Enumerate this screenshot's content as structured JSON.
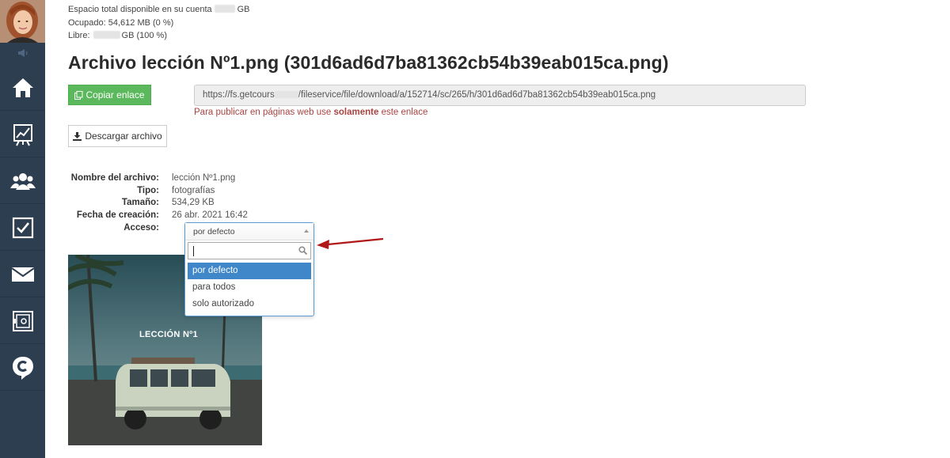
{
  "storage": {
    "total_label": "Espacio total disponible en su cuenta",
    "total_unit": "GB",
    "used": "Ocupado: 54,612 MB (0 %)",
    "free_label": "Libre:",
    "free_unit": "GB (100 %)"
  },
  "file": {
    "title": "Archivo lección Nº1.png (301d6ad6d7ba81362cb54b39eab015ca.png)",
    "copy_button": "Copiar enlace",
    "url_prefix": "https://fs.getcours",
    "url_suffix": "/fileservice/file/download/a/152714/sc/265/h/301d6ad6d7ba81362cb54b39eab015ca.png",
    "warning_pre": "Para publicar en páginas web use",
    "warning_bold": "solamente",
    "warning_post": "este enlace",
    "download_button": "Descargar archivo"
  },
  "properties": [
    {
      "label": "Nombre del archivo:",
      "value": "lección Nº1.png"
    },
    {
      "label": "Tipo:",
      "value": "fotografías"
    },
    {
      "label": "Tamaño:",
      "value": "534,29 KB"
    },
    {
      "label": "Fecha de creación:",
      "value": "26 abr. 2021 16:42"
    },
    {
      "label": "Acceso:",
      "value": ""
    }
  ],
  "access_dropdown": {
    "selected": "por defecto",
    "search_value": "",
    "options": [
      "por defecto",
      "para todos",
      "solo autorizado"
    ],
    "highlighted_index": 0
  },
  "preview": {
    "caption": "LECCIÓN Nº1"
  },
  "sidebar": {
    "items": [
      "home-icon",
      "chart-icon",
      "users-icon",
      "tasks-icon",
      "mail-icon",
      "safe-icon",
      "getcourse-logo-icon"
    ]
  },
  "colors": {
    "sidebar": "#2c3e50",
    "copy_button": "#5cb85c",
    "warning": "#a94442",
    "dropdown_highlight": "#3f87c8",
    "annotation_arrow": "#b01818"
  }
}
